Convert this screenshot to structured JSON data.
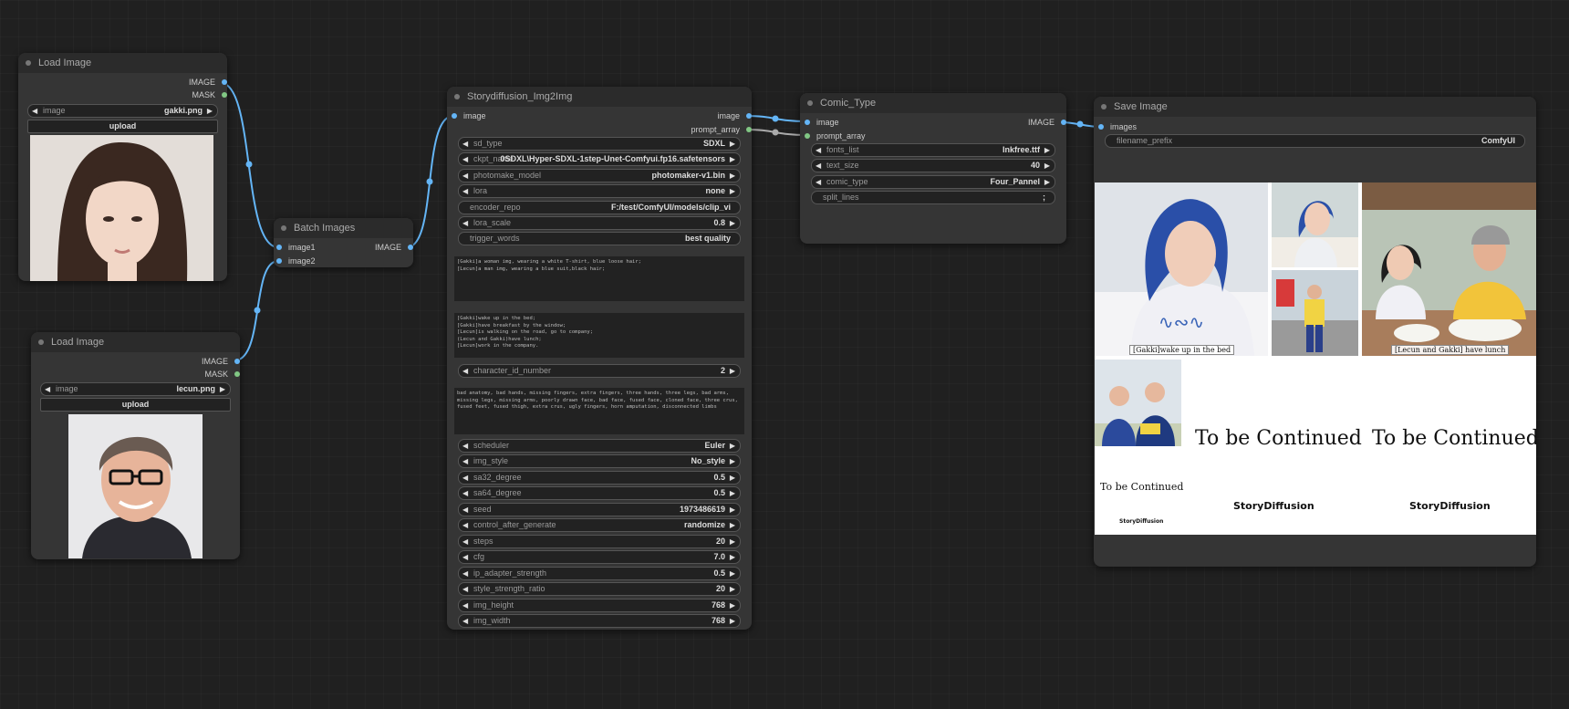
{
  "nodes": {
    "load1": {
      "title": "Load Image",
      "outputs": [
        "IMAGE",
        "MASK"
      ],
      "image_label": "image",
      "image_value": "gakki.png",
      "upload_label": "upload"
    },
    "load2": {
      "title": "Load Image",
      "outputs": [
        "IMAGE",
        "MASK"
      ],
      "image_label": "image",
      "image_value": "lecun.png",
      "upload_label": "upload"
    },
    "batch": {
      "title": "Batch Images",
      "inputs": [
        "image1",
        "image2"
      ],
      "output": "IMAGE"
    },
    "story": {
      "title": "Storydiffusion_Img2Img",
      "input": "image",
      "outputs": [
        "image",
        "prompt_array"
      ],
      "widgets_top": [
        {
          "label": "sd_type",
          "value": "SDXL"
        },
        {
          "label": "ckpt_name",
          "value": "0SDXL\\Hyper-SDXL-1step-Unet-Comfyui.fp16.safetensors"
        },
        {
          "label": "photomake_model",
          "value": "photomaker-v1.bin"
        },
        {
          "label": "lora",
          "value": "none"
        },
        {
          "label": "encoder_repo",
          "value": "F:/test/ComfyUI/models/clip_vi"
        },
        {
          "label": "lora_scale",
          "value": "0.8"
        },
        {
          "label": "trigger_words",
          "value": "best quality"
        }
      ],
      "char_prompt": "[Gakki]a woman img, wearing a white T-shirt, blue loose hair;\n[Lecun]a man img, wearing a blue suit,black hair;",
      "scene_prompt": "[Gakki]wake up in the bed;\n[Gakki]have breakfast by the window;\n[Lecun]is walking on the road, go to company;\n(Lecun and Gakki)have lunch;\n[Lecun]work in the company.",
      "char_id": {
        "label": "character_id_number",
        "value": "2"
      },
      "negative_prompt": "bad anatomy, bad hands, missing fingers, extra fingers, three hands, three legs, bad arms, missing legs, missing arms, poorly drawn face, bad face, fused face, cloned face, three crus, fused feet, fused thigh, extra crus, ugly fingers, horn amputation, disconnected limbs",
      "widgets_bottom": [
        {
          "label": "scheduler",
          "value": "Euler"
        },
        {
          "label": "img_style",
          "value": "No_style"
        },
        {
          "label": "sa32_degree",
          "value": "0.5"
        },
        {
          "label": "sa64_degree",
          "value": "0.5"
        },
        {
          "label": "seed",
          "value": "1973486619"
        },
        {
          "label": "control_after_generate",
          "value": "randomize"
        },
        {
          "label": "steps",
          "value": "20"
        },
        {
          "label": "cfg",
          "value": "7.0"
        },
        {
          "label": "ip_adapter_strength",
          "value": "0.5"
        },
        {
          "label": "style_strength_ratio",
          "value": "20"
        },
        {
          "label": "img_height",
          "value": "768"
        },
        {
          "label": "img_width",
          "value": "768"
        }
      ]
    },
    "comic": {
      "title": "Comic_Type",
      "inputs": [
        "image",
        "prompt_array"
      ],
      "output": "IMAGE",
      "widgets": [
        {
          "label": "fonts_list",
          "value": "Inkfree.ttf"
        },
        {
          "label": "text_size",
          "value": "40"
        },
        {
          "label": "comic_type",
          "value": "Four_Pannel"
        },
        {
          "label": "split_lines",
          "value": ";"
        }
      ]
    },
    "save": {
      "title": "Save Image",
      "input": "images",
      "prefix_label": "filename_prefix",
      "prefix_value": "ComfyUI",
      "captions": [
        "[Gakki]wake up in the bed",
        "[Lecun and Gakki] have lunch"
      ],
      "tbc": [
        "To be Continued",
        "To be Continued",
        "To be Continued"
      ],
      "logo": "StoryDiffusion"
    }
  },
  "colors": {
    "image_link": "#64b5f6",
    "mask_link": "#81c784",
    "prompt_link": "#aaaaaa",
    "node_bg": "#353535",
    "canvas_bg": "#202020"
  }
}
